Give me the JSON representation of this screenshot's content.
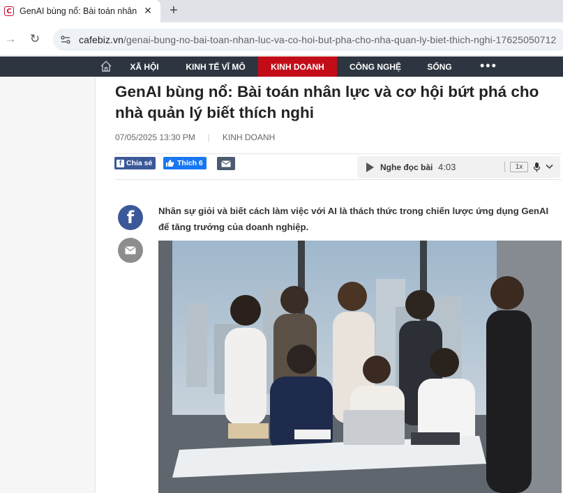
{
  "browser": {
    "tab_title": "GenAI bùng nổ: Bài toán nhân l",
    "favicon_letter": "C",
    "url_host": "cafebiz.vn",
    "url_path": "/genai-bung-no-bai-toan-nhan-luc-va-co-hoi-but-pha-cho-nha-quan-ly-biet-thich-nghi-17625050712"
  },
  "nav": {
    "items": [
      {
        "label": "XÃ HỘI"
      },
      {
        "label": "KINH TẾ VĨ MÔ"
      },
      {
        "label": "KINH DOANH",
        "active": true
      },
      {
        "label": "CÔNG NGHỆ"
      },
      {
        "label": "SỐNG"
      }
    ],
    "more": "•••",
    "active_color": "#c20d19",
    "bar_color": "#2d3640"
  },
  "article": {
    "title": "GenAI bùng nổ: Bài toán nhân lực và cơ hội bứt phá cho nhà quản lý biết thích nghi",
    "datetime": "07/05/2025 13:30 PM",
    "category": "KINH DOANH",
    "sapo": "Nhân sự giỏi và biết cách làm việc với AI là thách thức trong chiến lược ứng dụng GenAI để tăng trưởng của doanh nghiệp."
  },
  "share": {
    "fb_share": "Chia sẻ",
    "fb_like": "Thích 6"
  },
  "audio": {
    "label": "Nghe đọc bài",
    "duration": "4:03",
    "speed": "1x"
  },
  "icons": [
    "back-arrow-icon",
    "reload-icon",
    "site-info-icon",
    "home-icon",
    "play-icon",
    "mic-icon",
    "chevron-down-icon",
    "mail-icon",
    "facebook-icon"
  ]
}
